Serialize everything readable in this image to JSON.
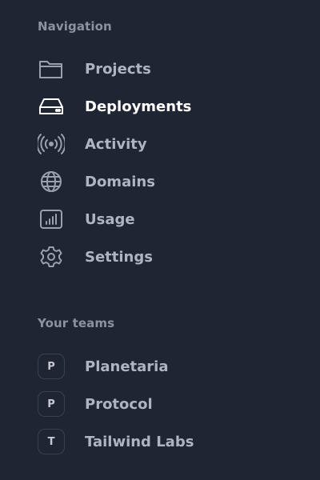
{
  "navigation": {
    "heading": "Navigation",
    "items": [
      {
        "label": "Projects",
        "icon": "folder-icon",
        "active": false
      },
      {
        "label": "Deployments",
        "icon": "server-icon",
        "active": true
      },
      {
        "label": "Activity",
        "icon": "signal-icon",
        "active": false
      },
      {
        "label": "Domains",
        "icon": "globe-icon",
        "active": false
      },
      {
        "label": "Usage",
        "icon": "bar-chart-icon",
        "active": false
      },
      {
        "label": "Settings",
        "icon": "gear-icon",
        "active": false
      }
    ]
  },
  "teams": {
    "heading": "Your teams",
    "items": [
      {
        "initial": "P",
        "label": "Planetaria"
      },
      {
        "initial": "P",
        "label": "Protocol"
      },
      {
        "initial": "T",
        "label": "Tailwind Labs"
      }
    ]
  },
  "colors": {
    "background": "#1f2533",
    "text": "#aeb4c0",
    "active_text": "#ffffff",
    "muted": "#8b93a1",
    "badge_border": "#3a4252"
  }
}
